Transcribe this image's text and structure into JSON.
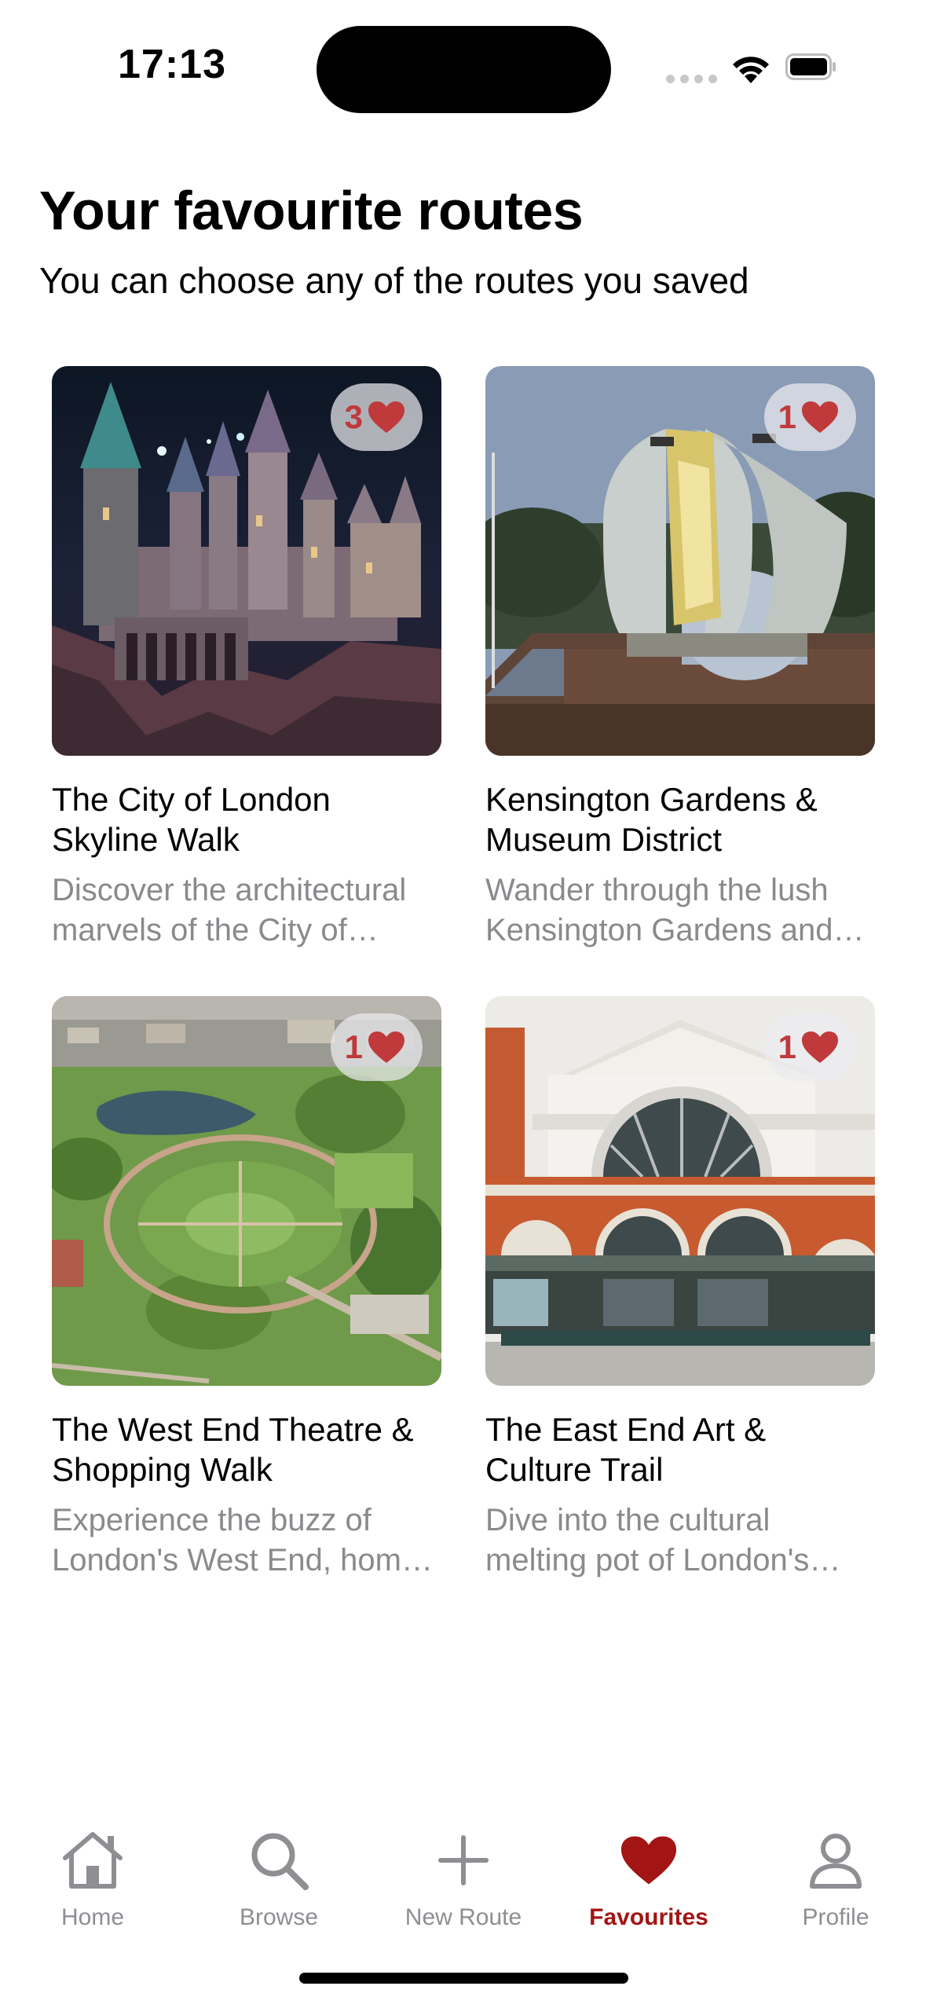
{
  "status_bar": {
    "time": "17:13"
  },
  "header": {
    "title": "Your favourite routes",
    "subtitle": "You can choose any of the routes you saved"
  },
  "routes": [
    {
      "title": "The City of London Skyline Walk",
      "description": "Discover the architectural marvels of the City of London",
      "favourites": "3"
    },
    {
      "title": "Kensington Gardens & Museum District",
      "description": "Wander through the lush Kensington Gardens and museums",
      "favourites": "1"
    },
    {
      "title": "The West End Theatre & Shopping Walk",
      "description": "Experience the buzz of London's West End, home to theatres",
      "favourites": "1"
    },
    {
      "title": "The East End Art & Culture Trail",
      "description": "Dive into the cultural melting pot of London's East End",
      "favourites": "1"
    }
  ],
  "tabbar": {
    "tabs": [
      {
        "label": "Home",
        "icon": "house-icon"
      },
      {
        "label": "Browse",
        "icon": "magnifier-icon"
      },
      {
        "label": "New Route",
        "icon": "plus-icon"
      },
      {
        "label": "Favourites",
        "icon": "heart-icon"
      },
      {
        "label": "Profile",
        "icon": "person-icon"
      }
    ],
    "active": "Favourites"
  },
  "colors": {
    "accent": "#a31515",
    "heart": "#c0393b",
    "inactive": "#8e8e93",
    "secondary_text": "#8a8a8e"
  }
}
